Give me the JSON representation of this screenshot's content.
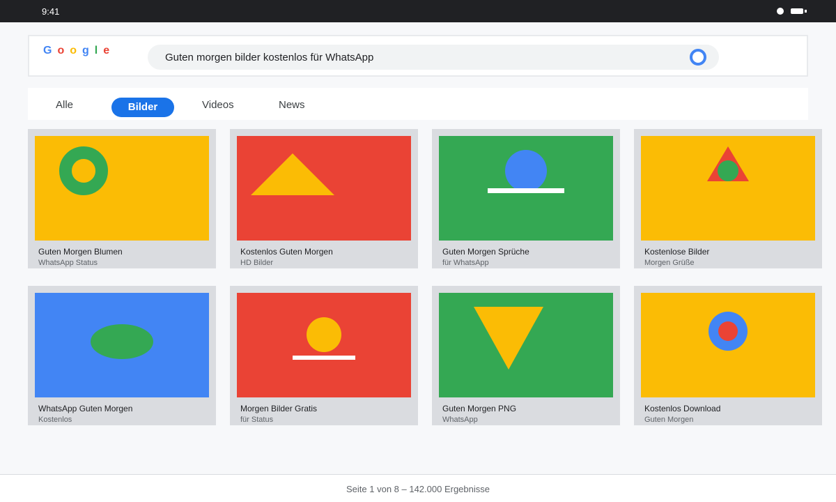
{
  "status_bar": {
    "time": "9:41"
  },
  "logo": {
    "letters": [
      "G",
      "o",
      "o",
      "g",
      "l",
      "e"
    ],
    "colors": [
      "#4285f4",
      "#ea4335",
      "#fbbc05",
      "#4285f4",
      "#34a853",
      "#ea4335"
    ]
  },
  "search": {
    "query": "Guten morgen bilder kostenlos für WhatsApp",
    "icon": "search-icon"
  },
  "tabs": [
    {
      "label": "Alle",
      "active": false
    },
    {
      "label": "Bilder",
      "active": true
    },
    {
      "label": "Videos",
      "active": false
    },
    {
      "label": "News",
      "active": false
    }
  ],
  "results": [
    {
      "title": "Guten Morgen Blumen",
      "subtitle": "WhatsApp Status",
      "background": "#fbbc05",
      "motif": "ring"
    },
    {
      "title": "Kostenlos Guten Morgen",
      "subtitle": "HD Bilder",
      "background": "#ea4335",
      "motif": "triangle"
    },
    {
      "title": "Guten Morgen Sprüche",
      "subtitle": "für WhatsApp",
      "background": "#34a853",
      "motif": "sun-on-line"
    },
    {
      "title": "Kostenlose Bilder",
      "subtitle": "Morgen Grüße",
      "background": "#fbbc05",
      "motif": "triangle-with-circle"
    },
    {
      "title": "WhatsApp Guten Morgen",
      "subtitle": "Kostenlos",
      "background": "#4285f4",
      "motif": "ellipse"
    },
    {
      "title": "Morgen Bilder Gratis",
      "subtitle": "für Status",
      "background": "#ea4335",
      "motif": "sun-on-line"
    },
    {
      "title": "Guten Morgen PNG",
      "subtitle": "WhatsApp",
      "background": "#34a853",
      "motif": "inverted-triangle"
    },
    {
      "title": "Kostenlos Download",
      "subtitle": "Guten Morgen",
      "background": "#fbbc05",
      "motif": "target"
    }
  ],
  "footer": {
    "pagination": "Seite 1 von 8 – 142.000 Ergebnisse"
  }
}
